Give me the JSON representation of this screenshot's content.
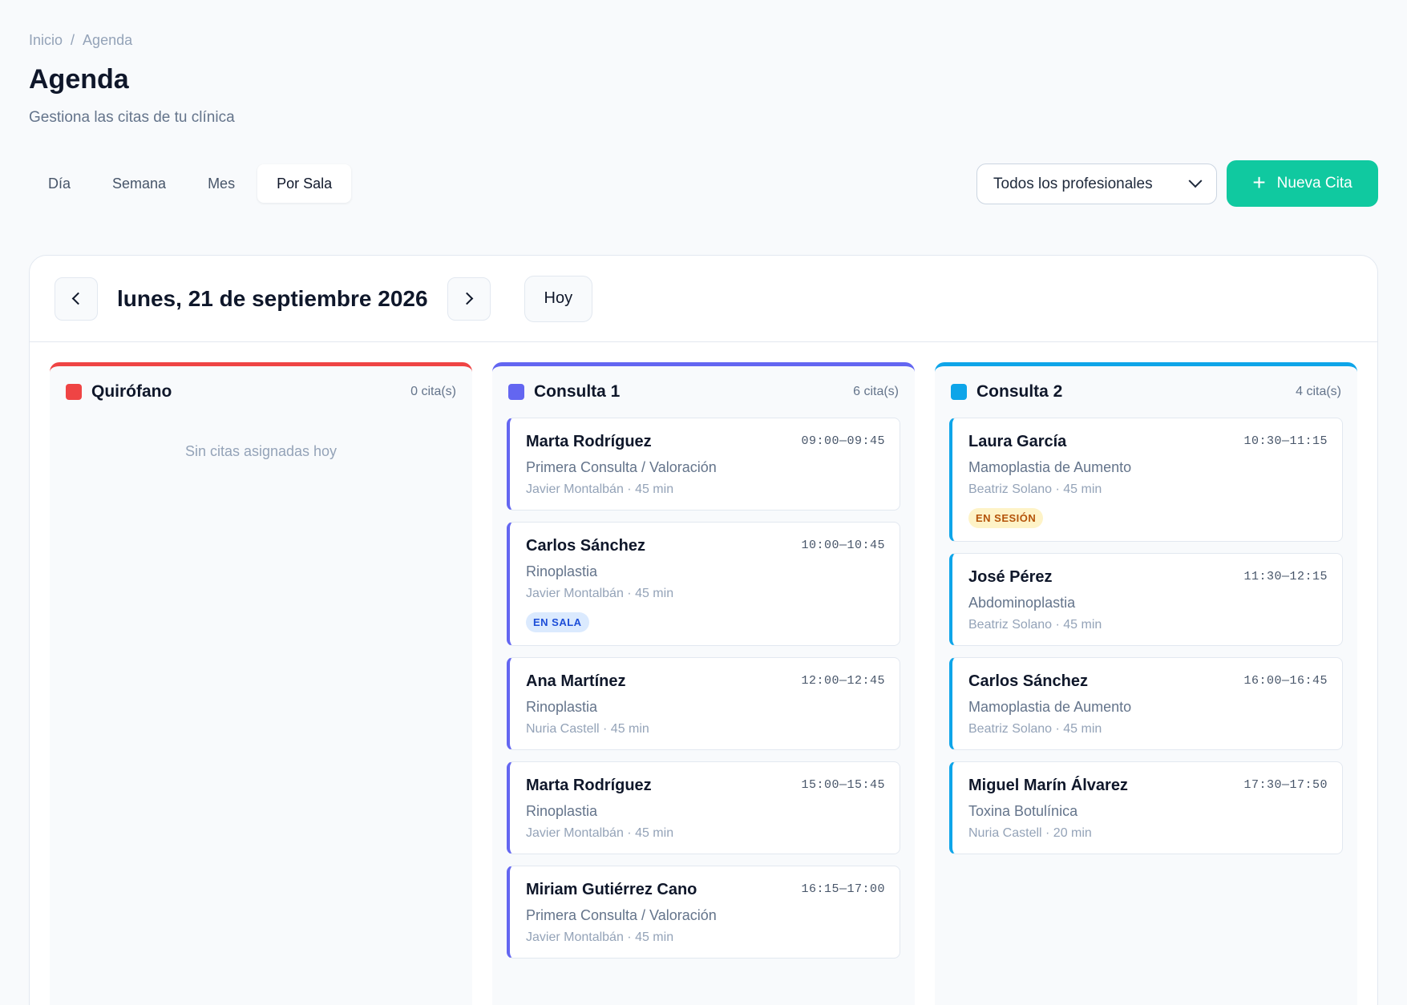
{
  "breadcrumb": {
    "home": "Inicio",
    "separator": "/",
    "current": "Agenda"
  },
  "page": {
    "title": "Agenda",
    "subtitle": "Gestiona las citas de tu clínica"
  },
  "tabs": [
    {
      "label": "Día",
      "active": false
    },
    {
      "label": "Semana",
      "active": false
    },
    {
      "label": "Mes",
      "active": false
    },
    {
      "label": "Por Sala",
      "active": true
    }
  ],
  "filter": {
    "selected": "Todos los profesionales"
  },
  "actions": {
    "new_label": "Nueva Cita",
    "new_icon": "plus-icon",
    "accent": "#10c9a0"
  },
  "date_nav": {
    "date_label": "lunes, 21 de septiembre 2026",
    "today_label": "Hoy"
  },
  "rooms": [
    {
      "name": "Quirófano",
      "color": "#ef4444",
      "count": "0 cita(s)",
      "empty_text": "Sin citas asignadas hoy",
      "appointments": []
    },
    {
      "name": "Consulta 1",
      "color": "#6366f1",
      "count": "6 cita(s)",
      "empty_text": "",
      "appointments": [
        {
          "patient": "Marta Rodríguez",
          "time": "09:00—09:45",
          "procedure": "Primera Consulta / Valoración",
          "meta": "Javier Montalbán · 45 min",
          "badge": ""
        },
        {
          "patient": "Carlos Sánchez",
          "time": "10:00—10:45",
          "procedure": "Rinoplastia",
          "meta": "Javier Montalbán · 45 min",
          "badge": "EN SALA"
        },
        {
          "patient": "Ana Martínez",
          "time": "12:00—12:45",
          "procedure": "Rinoplastia",
          "meta": "Nuria Castell · 45 min",
          "badge": ""
        },
        {
          "patient": "Marta Rodríguez",
          "time": "15:00—15:45",
          "procedure": "Rinoplastia",
          "meta": "Javier Montalbán · 45 min",
          "badge": ""
        },
        {
          "patient": "Miriam Gutiérrez Cano",
          "time": "16:15—17:00",
          "procedure": "Primera Consulta / Valoración",
          "meta": "Javier Montalbán · 45 min",
          "badge": ""
        }
      ]
    },
    {
      "name": "Consulta 2",
      "color": "#0ea5e9",
      "count": "4 cita(s)",
      "empty_text": "",
      "appointments": [
        {
          "patient": "Laura García",
          "time": "10:30—11:15",
          "procedure": "Mamoplastia de Aumento",
          "meta": "Beatriz Solano · 45 min",
          "badge": "EN SESIÓN"
        },
        {
          "patient": "José Pérez",
          "time": "11:30—12:15",
          "procedure": "Abdominoplastia",
          "meta": "Beatriz Solano · 45 min",
          "badge": ""
        },
        {
          "patient": "Carlos Sánchez",
          "time": "16:00—16:45",
          "procedure": "Mamoplastia de Aumento",
          "meta": "Beatriz Solano · 45 min",
          "badge": ""
        },
        {
          "patient": "Miguel Marín Álvarez",
          "time": "17:30—17:50",
          "procedure": "Toxina Botulínica",
          "meta": "Nuria Castell · 20 min",
          "badge": ""
        }
      ]
    }
  ]
}
